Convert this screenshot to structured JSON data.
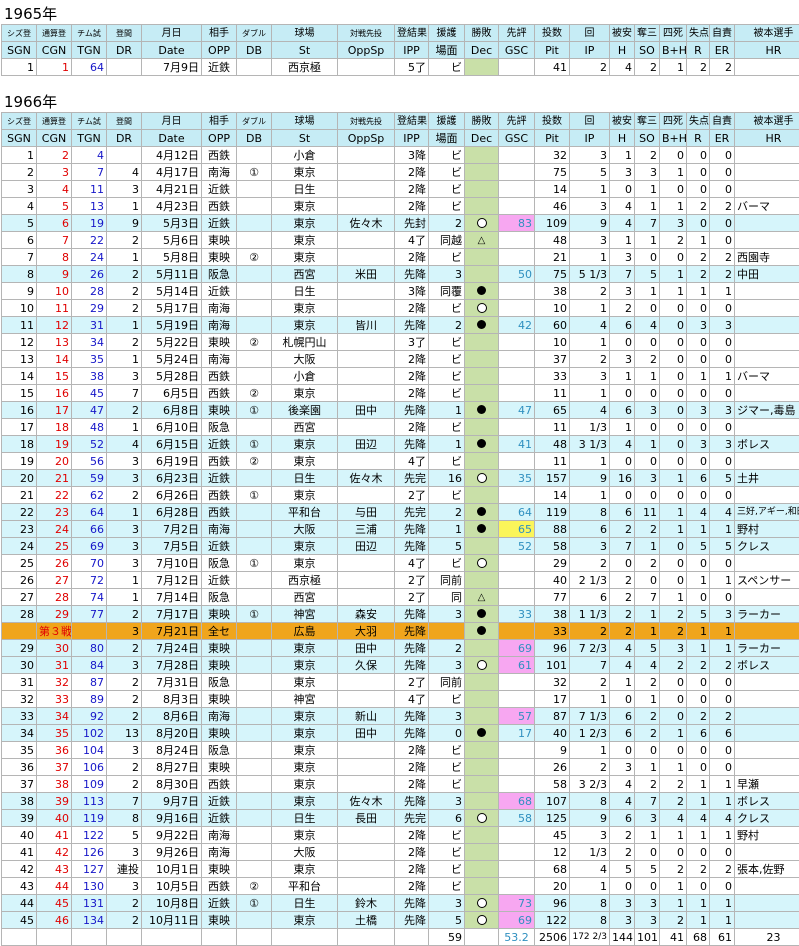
{
  "year1": "1965年",
  "year2": "1966年",
  "header_jp": [
    "シズ登",
    "通算登",
    "チム試",
    "登間",
    "月日",
    "相手",
    "ダブル",
    "球場",
    "対戦先投",
    "登結果",
    "援護",
    "勝敗",
    "先評",
    "投数",
    "回",
    "被安",
    "奪三",
    "四死",
    "失点",
    "自責",
    "被本選手"
  ],
  "header_en": [
    "SGN",
    "CGN",
    "TGN",
    "DR",
    "Date",
    "OPP",
    "DB",
    "St",
    "OppSp",
    "IPP",
    "場面",
    "Dec",
    "GSC",
    "Pit",
    "IP",
    "H",
    "SO",
    "B+H",
    "R",
    "ER",
    "HR"
  ],
  "rows1965": [
    {
      "sgn": "1",
      "cgn": "1",
      "tgn": "64",
      "dr": "",
      "date": "7月9日",
      "opp": "近鉄",
      "db": "",
      "st": "西京極",
      "oppsp": "",
      "ipp": "5了",
      "sc": "ビ",
      "dec": "",
      "gsc": "",
      "pit": "41",
      "ip": "2",
      "h": "4",
      "so": "2",
      "bh": "1",
      "r": "2",
      "er": "2",
      "hr": ""
    }
  ],
  "rows1966": [
    {
      "sgn": "1",
      "cgn": "2",
      "tgn": "4",
      "dr": "",
      "date": "4月12日",
      "opp": "西鉄",
      "db": "",
      "st": "小倉",
      "oppsp": "",
      "ipp": "3降",
      "sc": "ビ",
      "dec": "",
      "gsc": "",
      "pit": "32",
      "ip": "3",
      "h": "1",
      "so": "2",
      "bh": "0",
      "r": "0",
      "er": "0",
      "hr": ""
    },
    {
      "sgn": "2",
      "cgn": "3",
      "tgn": "7",
      "dr": "4",
      "date": "4月17日",
      "opp": "南海",
      "db": "①",
      "st": "東京",
      "oppsp": "",
      "ipp": "2降",
      "sc": "ビ",
      "dec": "",
      "gsc": "",
      "pit": "75",
      "ip": "5",
      "h": "3",
      "so": "3",
      "bh": "1",
      "r": "0",
      "er": "0",
      "hr": ""
    },
    {
      "sgn": "3",
      "cgn": "4",
      "tgn": "11",
      "dr": "3",
      "date": "4月21日",
      "opp": "近鉄",
      "db": "",
      "st": "日生",
      "oppsp": "",
      "ipp": "2降",
      "sc": "ビ",
      "dec": "",
      "gsc": "",
      "pit": "14",
      "ip": "1",
      "h": "0",
      "so": "1",
      "bh": "0",
      "r": "0",
      "er": "0",
      "hr": ""
    },
    {
      "sgn": "4",
      "cgn": "5",
      "tgn": "13",
      "dr": "1",
      "date": "4月23日",
      "opp": "西鉄",
      "db": "",
      "st": "東京",
      "oppsp": "",
      "ipp": "2降",
      "sc": "ビ",
      "dec": "",
      "gsc": "",
      "pit": "46",
      "ip": "3",
      "h": "4",
      "so": "1",
      "bh": "1",
      "r": "2",
      "er": "2",
      "hr": "バーマ"
    },
    {
      "sgn": "5",
      "cgn": "6",
      "tgn": "19",
      "dr": "9",
      "date": "5月3日",
      "opp": "近鉄",
      "db": "",
      "st": "東京",
      "oppsp": "佐々木",
      "ipp": "先封",
      "sc": "2",
      "dec": "○",
      "gsc": "83",
      "pit": "109",
      "ip": "9",
      "h": "4",
      "so": "7",
      "bh": "3",
      "r": "0",
      "er": "0",
      "hr": "",
      "hl": "cyan",
      "g": "gp"
    },
    {
      "sgn": "6",
      "cgn": "7",
      "tgn": "22",
      "dr": "2",
      "date": "5月6日",
      "opp": "東映",
      "db": "",
      "st": "東京",
      "oppsp": "",
      "ipp": "4了",
      "sc": "同越",
      "dec": "△",
      "gsc": "",
      "pit": "48",
      "ip": "3",
      "h": "1",
      "so": "1",
      "bh": "2",
      "r": "1",
      "er": "0",
      "hr": ""
    },
    {
      "sgn": "7",
      "cgn": "8",
      "tgn": "24",
      "dr": "1",
      "date": "5月8日",
      "opp": "東映",
      "db": "②",
      "st": "東京",
      "oppsp": "",
      "ipp": "2降",
      "sc": "ビ",
      "dec": "",
      "gsc": "",
      "pit": "21",
      "ip": "1",
      "h": "3",
      "so": "0",
      "bh": "0",
      "r": "2",
      "er": "2",
      "hr": "西園寺"
    },
    {
      "sgn": "8",
      "cgn": "9",
      "tgn": "26",
      "dr": "2",
      "date": "5月11日",
      "opp": "阪急",
      "db": "",
      "st": "西宮",
      "oppsp": "米田",
      "ipp": "先降",
      "sc": "3",
      "dec": "",
      "gsc": "50",
      "pit": "75",
      "ip": "5 1/3",
      "h": "7",
      "so": "5",
      "bh": "1",
      "r": "2",
      "er": "2",
      "hr": "中田",
      "hl": "cyan"
    },
    {
      "sgn": "9",
      "cgn": "10",
      "tgn": "28",
      "dr": "2",
      "date": "5月14日",
      "opp": "近鉄",
      "db": "",
      "st": "日生",
      "oppsp": "",
      "ipp": "3降",
      "sc": "同覆",
      "dec": "●",
      "gsc": "",
      "pit": "38",
      "ip": "2",
      "h": "3",
      "so": "1",
      "bh": "1",
      "r": "1",
      "er": "1",
      "hr": ""
    },
    {
      "sgn": "10",
      "cgn": "11",
      "tgn": "29",
      "dr": "2",
      "date": "5月17日",
      "opp": "南海",
      "db": "",
      "st": "東京",
      "oppsp": "",
      "ipp": "2降",
      "sc": "ビ",
      "dec": "○",
      "gsc": "",
      "pit": "10",
      "ip": "1",
      "h": "2",
      "so": "0",
      "bh": "0",
      "r": "0",
      "er": "0",
      "hr": ""
    },
    {
      "sgn": "11",
      "cgn": "12",
      "tgn": "31",
      "dr": "1",
      "date": "5月19日",
      "opp": "南海",
      "db": "",
      "st": "東京",
      "oppsp": "皆川",
      "ipp": "先降",
      "sc": "2",
      "dec": "●",
      "gsc": "42",
      "pit": "60",
      "ip": "4",
      "h": "6",
      "so": "4",
      "bh": "0",
      "r": "3",
      "er": "3",
      "hr": "",
      "hl": "cyan"
    },
    {
      "sgn": "12",
      "cgn": "13",
      "tgn": "34",
      "dr": "2",
      "date": "5月22日",
      "opp": "東映",
      "db": "②",
      "st": "札幌円山",
      "oppsp": "",
      "ipp": "3了",
      "sc": "ビ",
      "dec": "",
      "gsc": "",
      "pit": "10",
      "ip": "1",
      "h": "0",
      "so": "0",
      "bh": "0",
      "r": "0",
      "er": "0",
      "hr": ""
    },
    {
      "sgn": "13",
      "cgn": "14",
      "tgn": "35",
      "dr": "1",
      "date": "5月24日",
      "opp": "南海",
      "db": "",
      "st": "大阪",
      "oppsp": "",
      "ipp": "2降",
      "sc": "ビ",
      "dec": "",
      "gsc": "",
      "pit": "37",
      "ip": "2",
      "h": "3",
      "so": "2",
      "bh": "0",
      "r": "0",
      "er": "0",
      "hr": ""
    },
    {
      "sgn": "14",
      "cgn": "15",
      "tgn": "38",
      "dr": "3",
      "date": "5月28日",
      "opp": "西鉄",
      "db": "",
      "st": "小倉",
      "oppsp": "",
      "ipp": "2降",
      "sc": "ビ",
      "dec": "",
      "gsc": "",
      "pit": "33",
      "ip": "3",
      "h": "1",
      "so": "1",
      "bh": "0",
      "r": "1",
      "er": "1",
      "hr": "バーマ"
    },
    {
      "sgn": "15",
      "cgn": "16",
      "tgn": "45",
      "dr": "7",
      "date": "6月5日",
      "opp": "西鉄",
      "db": "②",
      "st": "東京",
      "oppsp": "",
      "ipp": "2降",
      "sc": "ビ",
      "dec": "",
      "gsc": "",
      "pit": "11",
      "ip": "1",
      "h": "0",
      "so": "0",
      "bh": "0",
      "r": "0",
      "er": "0",
      "hr": ""
    },
    {
      "sgn": "16",
      "cgn": "17",
      "tgn": "47",
      "dr": "2",
      "date": "6月8日",
      "opp": "東映",
      "db": "①",
      "st": "後楽園",
      "oppsp": "田中",
      "ipp": "先降",
      "sc": "1",
      "dec": "●",
      "gsc": "47",
      "pit": "65",
      "ip": "4",
      "h": "6",
      "so": "3",
      "bh": "0",
      "r": "3",
      "er": "3",
      "hr": "ジマー,毒島",
      "hl": "cyan"
    },
    {
      "sgn": "17",
      "cgn": "18",
      "tgn": "48",
      "dr": "1",
      "date": "6月10日",
      "opp": "阪急",
      "db": "",
      "st": "西宮",
      "oppsp": "",
      "ipp": "2降",
      "sc": "ビ",
      "dec": "",
      "gsc": "",
      "pit": "11",
      "ip": "1/3",
      "h": "1",
      "so": "0",
      "bh": "0",
      "r": "0",
      "er": "0",
      "hr": ""
    },
    {
      "sgn": "18",
      "cgn": "19",
      "tgn": "52",
      "dr": "4",
      "date": "6月15日",
      "opp": "近鉄",
      "db": "①",
      "st": "東京",
      "oppsp": "田辺",
      "ipp": "先降",
      "sc": "1",
      "dec": "●",
      "gsc": "41",
      "pit": "48",
      "ip": "3 1/3",
      "h": "4",
      "so": "1",
      "bh": "0",
      "r": "3",
      "er": "3",
      "hr": "ボレス",
      "hl": "cyan"
    },
    {
      "sgn": "19",
      "cgn": "20",
      "tgn": "56",
      "dr": "3",
      "date": "6月19日",
      "opp": "西鉄",
      "db": "②",
      "st": "東京",
      "oppsp": "",
      "ipp": "4了",
      "sc": "ビ",
      "dec": "",
      "gsc": "",
      "pit": "11",
      "ip": "1",
      "h": "0",
      "so": "0",
      "bh": "0",
      "r": "0",
      "er": "0",
      "hr": ""
    },
    {
      "sgn": "20",
      "cgn": "21",
      "tgn": "59",
      "dr": "3",
      "date": "6月23日",
      "opp": "近鉄",
      "db": "",
      "st": "日生",
      "oppsp": "佐々木",
      "ipp": "先完",
      "sc": "16",
      "dec": "○",
      "gsc": "35",
      "pit": "157",
      "ip": "9",
      "h": "16",
      "so": "3",
      "bh": "1",
      "r": "6",
      "er": "5",
      "hr": "土井",
      "hl": "cyan"
    },
    {
      "sgn": "21",
      "cgn": "22",
      "tgn": "62",
      "dr": "2",
      "date": "6月26日",
      "opp": "西鉄",
      "db": "①",
      "st": "東京",
      "oppsp": "",
      "ipp": "2了",
      "sc": "ビ",
      "dec": "",
      "gsc": "",
      "pit": "14",
      "ip": "1",
      "h": "0",
      "so": "0",
      "bh": "0",
      "r": "0",
      "er": "0",
      "hr": ""
    },
    {
      "sgn": "22",
      "cgn": "23",
      "tgn": "64",
      "dr": "1",
      "date": "6月28日",
      "opp": "西鉄",
      "db": "",
      "st": "平和台",
      "oppsp": "与田",
      "ipp": "先完",
      "sc": "2",
      "dec": "●",
      "gsc": "64",
      "pit": "119",
      "ip": "8",
      "h": "6",
      "so": "11",
      "bh": "1",
      "r": "4",
      "er": "4",
      "hr": "三好,アギー,和田",
      "hl": "cyan"
    },
    {
      "sgn": "23",
      "cgn": "24",
      "tgn": "66",
      "dr": "3",
      "date": "7月2日",
      "opp": "南海",
      "db": "",
      "st": "大阪",
      "oppsp": "三浦",
      "ipp": "先降",
      "sc": "1",
      "dec": "●",
      "gsc": "65",
      "pit": "88",
      "ip": "6",
      "h": "2",
      "so": "2",
      "bh": "1",
      "r": "1",
      "er": "1",
      "hr": "野村",
      "hl": "cyan",
      "g": "gy"
    },
    {
      "sgn": "24",
      "cgn": "25",
      "tgn": "69",
      "dr": "3",
      "date": "7月5日",
      "opp": "近鉄",
      "db": "",
      "st": "東京",
      "oppsp": "田辺",
      "ipp": "先降",
      "sc": "5",
      "dec": "",
      "gsc": "52",
      "pit": "58",
      "ip": "3",
      "h": "7",
      "so": "1",
      "bh": "0",
      "r": "5",
      "er": "5",
      "hr": "クレス",
      "hl": "cyan"
    },
    {
      "sgn": "25",
      "cgn": "26",
      "tgn": "70",
      "dr": "3",
      "date": "7月10日",
      "opp": "阪急",
      "db": "①",
      "st": "東京",
      "oppsp": "",
      "ipp": "4了",
      "sc": "ビ",
      "dec": "○",
      "gsc": "",
      "pit": "29",
      "ip": "2",
      "h": "0",
      "so": "2",
      "bh": "0",
      "r": "0",
      "er": "0",
      "hr": ""
    },
    {
      "sgn": "26",
      "cgn": "27",
      "tgn": "72",
      "dr": "1",
      "date": "7月12日",
      "opp": "近鉄",
      "db": "",
      "st": "西京極",
      "oppsp": "",
      "ipp": "2了",
      "sc": "同前",
      "dec": "",
      "gsc": "",
      "pit": "40",
      "ip": "2 1/3",
      "h": "2",
      "so": "0",
      "bh": "0",
      "r": "1",
      "er": "1",
      "hr": "スペンサー"
    },
    {
      "sgn": "27",
      "cgn": "28",
      "tgn": "74",
      "dr": "1",
      "date": "7月14日",
      "opp": "阪急",
      "db": "",
      "st": "西宮",
      "oppsp": "",
      "ipp": "2了",
      "sc": "同",
      "dec": "△",
      "gsc": "",
      "pit": "77",
      "ip": "6",
      "h": "2",
      "so": "7",
      "bh": "1",
      "r": "0",
      "er": "0",
      "hr": ""
    },
    {
      "sgn": "28",
      "cgn": "29",
      "tgn": "77",
      "dr": "2",
      "date": "7月17日",
      "opp": "東映",
      "db": "①",
      "st": "神宮",
      "oppsp": "森安",
      "ipp": "先降",
      "sc": "3",
      "dec": "●",
      "gsc": "33",
      "pit": "38",
      "ip": "1 1/3",
      "h": "2",
      "so": "1",
      "bh": "2",
      "r": "5",
      "er": "3",
      "hr": "ラーカー",
      "hl": "cyan"
    },
    {
      "sgn": "",
      "cgn": "第３戦",
      "tgn": "",
      "dr": "3",
      "date": "7月21日",
      "opp": "全セ",
      "db": "",
      "st": "広島",
      "oppsp": "大羽",
      "ipp": "先降",
      "sc": "",
      "dec": "●",
      "gsc": "",
      "pit": "33",
      "ip": "2",
      "h": "2",
      "so": "1",
      "bh": "2",
      "r": "1",
      "er": "1",
      "hr": "",
      "hl": "orange"
    },
    {
      "sgn": "29",
      "cgn": "30",
      "tgn": "80",
      "dr": "2",
      "date": "7月24日",
      "opp": "東映",
      "db": "",
      "st": "東京",
      "oppsp": "田中",
      "ipp": "先降",
      "sc": "2",
      "dec": "",
      "gsc": "69",
      "pit": "96",
      "ip": "7 2/3",
      "h": "4",
      "so": "5",
      "bh": "3",
      "r": "1",
      "er": "1",
      "hr": "ラーカー",
      "hl": "cyan",
      "g": "gp"
    },
    {
      "sgn": "30",
      "cgn": "31",
      "tgn": "84",
      "dr": "3",
      "date": "7月28日",
      "opp": "東映",
      "db": "",
      "st": "東京",
      "oppsp": "久保",
      "ipp": "先降",
      "sc": "3",
      "dec": "○",
      "gsc": "61",
      "pit": "101",
      "ip": "7",
      "h": "4",
      "so": "4",
      "bh": "2",
      "r": "2",
      "er": "2",
      "hr": "ボレス",
      "hl": "cyan",
      "g": "gp"
    },
    {
      "sgn": "31",
      "cgn": "32",
      "tgn": "87",
      "dr": "2",
      "date": "7月31日",
      "opp": "阪急",
      "db": "",
      "st": "東京",
      "oppsp": "",
      "ipp": "2了",
      "sc": "同前",
      "dec": "",
      "gsc": "",
      "pit": "32",
      "ip": "2",
      "h": "1",
      "so": "2",
      "bh": "0",
      "r": "0",
      "er": "0",
      "hr": ""
    },
    {
      "sgn": "32",
      "cgn": "33",
      "tgn": "89",
      "dr": "2",
      "date": "8月3日",
      "opp": "東映",
      "db": "",
      "st": "神宮",
      "oppsp": "",
      "ipp": "4了",
      "sc": "ビ",
      "dec": "",
      "gsc": "",
      "pit": "17",
      "ip": "1",
      "h": "0",
      "so": "1",
      "bh": "0",
      "r": "0",
      "er": "0",
      "hr": ""
    },
    {
      "sgn": "33",
      "cgn": "34",
      "tgn": "92",
      "dr": "2",
      "date": "8月6日",
      "opp": "南海",
      "db": "",
      "st": "東京",
      "oppsp": "新山",
      "ipp": "先降",
      "sc": "3",
      "dec": "",
      "gsc": "57",
      "pit": "87",
      "ip": "7 1/3",
      "h": "6",
      "so": "2",
      "bh": "0",
      "r": "2",
      "er": "2",
      "hr": "",
      "hl": "cyan",
      "g": "gp"
    },
    {
      "sgn": "34",
      "cgn": "35",
      "tgn": "102",
      "dr": "13",
      "date": "8月20日",
      "opp": "東映",
      "db": "",
      "st": "東京",
      "oppsp": "田中",
      "ipp": "先降",
      "sc": "0",
      "dec": "●",
      "gsc": "17",
      "pit": "40",
      "ip": "1 2/3",
      "h": "6",
      "so": "2",
      "bh": "1",
      "r": "6",
      "er": "6",
      "hr": "",
      "hl": "cyan"
    },
    {
      "sgn": "35",
      "cgn": "36",
      "tgn": "104",
      "dr": "3",
      "date": "8月24日",
      "opp": "阪急",
      "db": "",
      "st": "東京",
      "oppsp": "",
      "ipp": "2降",
      "sc": "ビ",
      "dec": "",
      "gsc": "",
      "pit": "9",
      "ip": "1",
      "h": "0",
      "so": "0",
      "bh": "0",
      "r": "0",
      "er": "0",
      "hr": ""
    },
    {
      "sgn": "36",
      "cgn": "37",
      "tgn": "106",
      "dr": "2",
      "date": "8月27日",
      "opp": "東映",
      "db": "",
      "st": "東京",
      "oppsp": "",
      "ipp": "2降",
      "sc": "ビ",
      "dec": "",
      "gsc": "",
      "pit": "26",
      "ip": "2",
      "h": "3",
      "so": "1",
      "bh": "1",
      "r": "0",
      "er": "0",
      "hr": ""
    },
    {
      "sgn": "37",
      "cgn": "38",
      "tgn": "109",
      "dr": "2",
      "date": "8月30日",
      "opp": "西鉄",
      "db": "",
      "st": "東京",
      "oppsp": "",
      "ipp": "2降",
      "sc": "ビ",
      "dec": "",
      "gsc": "",
      "pit": "58",
      "ip": "3 2/3",
      "h": "4",
      "so": "2",
      "bh": "2",
      "r": "1",
      "er": "1",
      "hr": "早瀬"
    },
    {
      "sgn": "38",
      "cgn": "39",
      "tgn": "113",
      "dr": "7",
      "date": "9月7日",
      "opp": "近鉄",
      "db": "",
      "st": "東京",
      "oppsp": "佐々木",
      "ipp": "先降",
      "sc": "3",
      "dec": "",
      "gsc": "68",
      "pit": "107",
      "ip": "8",
      "h": "4",
      "so": "7",
      "bh": "2",
      "r": "1",
      "er": "1",
      "hr": "ボレス",
      "hl": "cyan",
      "g": "gp"
    },
    {
      "sgn": "39",
      "cgn": "40",
      "tgn": "119",
      "dr": "8",
      "date": "9月16日",
      "opp": "近鉄",
      "db": "",
      "st": "日生",
      "oppsp": "長田",
      "ipp": "先完",
      "sc": "6",
      "dec": "○",
      "gsc": "58",
      "pit": "125",
      "ip": "9",
      "h": "6",
      "so": "3",
      "bh": "4",
      "r": "4",
      "er": "4",
      "hr": "クレス",
      "hl": "cyan"
    },
    {
      "sgn": "40",
      "cgn": "41",
      "tgn": "122",
      "dr": "5",
      "date": "9月22日",
      "opp": "南海",
      "db": "",
      "st": "東京",
      "oppsp": "",
      "ipp": "2降",
      "sc": "ビ",
      "dec": "",
      "gsc": "",
      "pit": "45",
      "ip": "3",
      "h": "2",
      "so": "1",
      "bh": "1",
      "r": "1",
      "er": "1",
      "hr": "野村"
    },
    {
      "sgn": "41",
      "cgn": "42",
      "tgn": "126",
      "dr": "3",
      "date": "9月26日",
      "opp": "南海",
      "db": "",
      "st": "大阪",
      "oppsp": "",
      "ipp": "2降",
      "sc": "ビ",
      "dec": "",
      "gsc": "",
      "pit": "12",
      "ip": "1/3",
      "h": "2",
      "so": "0",
      "bh": "0",
      "r": "0",
      "er": "0",
      "hr": ""
    },
    {
      "sgn": "42",
      "cgn": "43",
      "tgn": "127",
      "dr": "連投",
      "date": "10月1日",
      "opp": "東映",
      "db": "",
      "st": "東京",
      "oppsp": "",
      "ipp": "2降",
      "sc": "ビ",
      "dec": "",
      "gsc": "",
      "pit": "68",
      "ip": "4",
      "h": "5",
      "so": "5",
      "bh": "2",
      "r": "2",
      "er": "2",
      "hr": "張本,佐野"
    },
    {
      "sgn": "43",
      "cgn": "44",
      "tgn": "130",
      "dr": "3",
      "date": "10月5日",
      "opp": "西鉄",
      "db": "②",
      "st": "平和台",
      "oppsp": "",
      "ipp": "2降",
      "sc": "ビ",
      "dec": "",
      "gsc": "",
      "pit": "20",
      "ip": "1",
      "h": "0",
      "so": "0",
      "bh": "1",
      "r": "0",
      "er": "0",
      "hr": ""
    },
    {
      "sgn": "44",
      "cgn": "45",
      "tgn": "131",
      "dr": "2",
      "date": "10月8日",
      "opp": "近鉄",
      "db": "①",
      "st": "日生",
      "oppsp": "鈴木",
      "ipp": "先降",
      "sc": "3",
      "dec": "○",
      "gsc": "73",
      "pit": "96",
      "ip": "8",
      "h": "3",
      "so": "3",
      "bh": "1",
      "r": "1",
      "er": "1",
      "hr": "",
      "hl": "cyan",
      "g": "gp"
    },
    {
      "sgn": "45",
      "cgn": "46",
      "tgn": "134",
      "dr": "2",
      "date": "10月11日",
      "opp": "東映",
      "db": "",
      "st": "東京",
      "oppsp": "土橋",
      "ipp": "先降",
      "sc": "5",
      "dec": "○",
      "gsc": "69",
      "pit": "122",
      "ip": "8",
      "h": "3",
      "so": "3",
      "bh": "2",
      "r": "1",
      "er": "1",
      "hr": "",
      "hl": "cyan",
      "g": "gp"
    }
  ],
  "totals": {
    "sc": "59",
    "gsc": "53.2",
    "pit": "2506",
    "ip": "172 2/3",
    "h": "144",
    "so": "101",
    "bh": "41",
    "r": "68",
    "er": "61",
    "hr": "23"
  }
}
